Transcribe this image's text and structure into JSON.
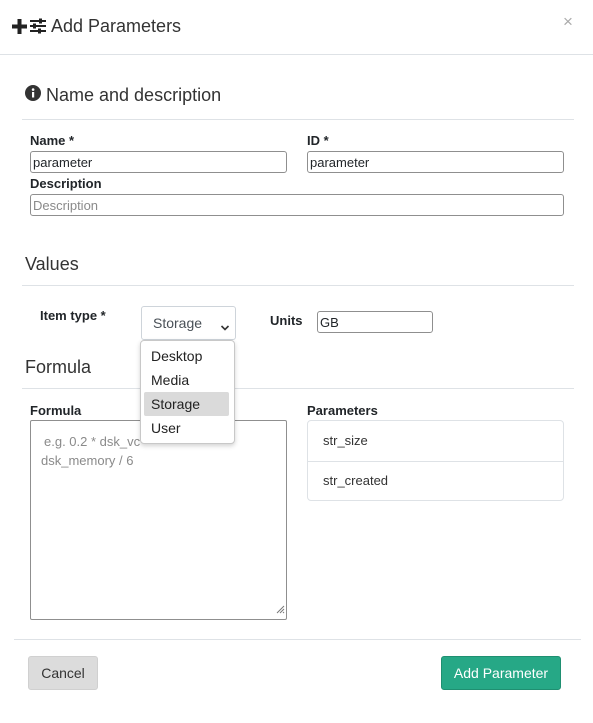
{
  "modal": {
    "title": "Add Parameters",
    "close_symbol": "×"
  },
  "sections": {
    "name_description": "Name and description",
    "values": "Values",
    "formula": "Formula"
  },
  "fields": {
    "name": {
      "label": "Name *",
      "value": "parameter"
    },
    "id": {
      "label": "ID *",
      "value": "parameter"
    },
    "description": {
      "label": "Description",
      "placeholder": "Description",
      "value": ""
    },
    "item_type": {
      "label": "Item type *",
      "selected": "Storage",
      "options": [
        "Desktop",
        "Media",
        "Storage",
        "User"
      ]
    },
    "units": {
      "label": "Units",
      "value": "GB"
    },
    "formula": {
      "label": "Formula",
      "placeholder_line1": "e.g. 0.2 * dsk_vc",
      "placeholder_line2": "dsk_memory / 6"
    },
    "parameters": {
      "label": "Parameters",
      "items": [
        "str_size",
        "str_created"
      ]
    }
  },
  "buttons": {
    "cancel": "Cancel",
    "add": "Add Parameter"
  },
  "colors": {
    "primary": "#26a886",
    "secondary_button": "#dcdcdc",
    "divider": "#dee2e6"
  }
}
